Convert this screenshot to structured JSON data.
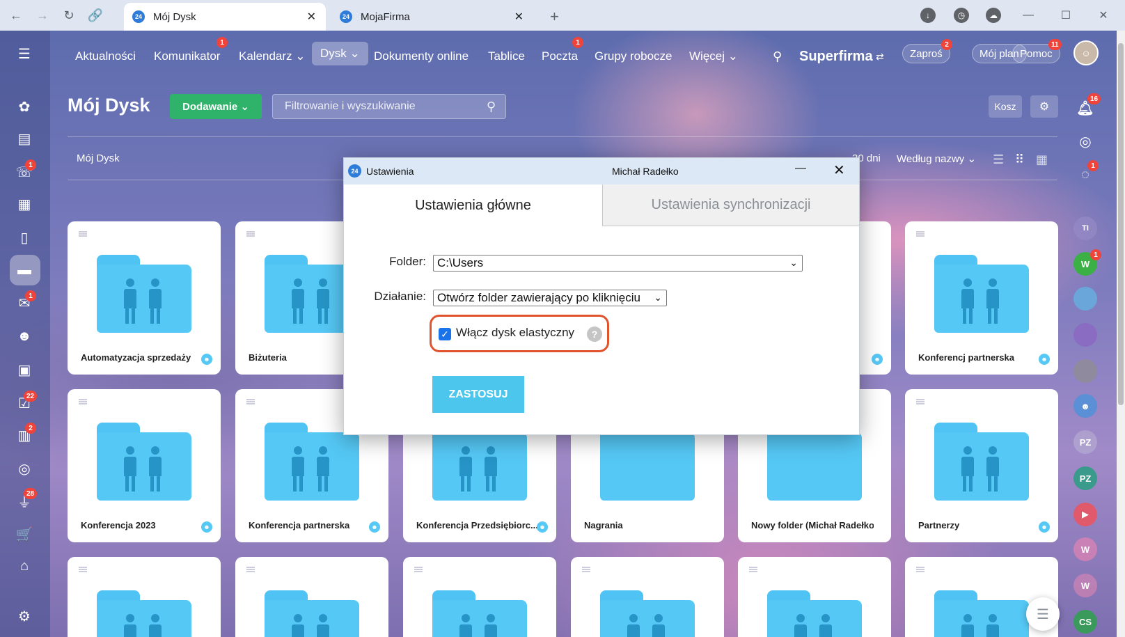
{
  "browser": {
    "tabs": [
      {
        "title": "Mój Dysk",
        "favicon": "24",
        "active": true
      },
      {
        "title": "MojaFirma",
        "favicon": "24",
        "active": false
      }
    ]
  },
  "topnav": {
    "items": [
      {
        "label": "Aktualności"
      },
      {
        "label": "Komunikator",
        "badge": "1"
      },
      {
        "label": "Kalendarz ⌄"
      },
      {
        "label": "Dysk ⌄"
      },
      {
        "label": "Dokumenty online"
      },
      {
        "label": "Tablice"
      },
      {
        "label": "Poczta",
        "badge": "1"
      },
      {
        "label": "Grupy robocze"
      },
      {
        "label": "Więcej ⌄"
      }
    ],
    "company": "Superfirma",
    "invite": "Zaproś",
    "invite_badge": "2",
    "my_plan": "Mój plan",
    "help": "Pomoc",
    "help_badge": "11"
  },
  "left_rail_badges": [
    "1",
    "1",
    "22",
    "2",
    "28"
  ],
  "right_rail": {
    "notify_badge": "16",
    "chat_badge": "1",
    "w_badge": "1",
    "avatars": [
      "TI",
      "W",
      "PZ",
      "PZ",
      "W",
      "W",
      "CS"
    ]
  },
  "page": {
    "title": "Mój Dysk",
    "add_button": "Dodawanie",
    "search_placeholder": "Filtrowanie i wyszukiwanie",
    "trash": "Kosz",
    "breadcrumb": "Mój Dysk",
    "days_text": "30 dni",
    "sort_label": "Według nazwy"
  },
  "folders": [
    {
      "name": "Automatyzacja sprzedaży",
      "shared": true
    },
    {
      "name": "Biżuteria",
      "shared": false
    },
    {
      "name": "Konferencj partnerska",
      "shared": true
    },
    {
      "name": "Konferencja 2023",
      "shared": true
    },
    {
      "name": "Konferencja partnerska",
      "shared": true
    },
    {
      "name": "Konferencja Przedsiębiorc...",
      "shared": true
    },
    {
      "name": "Nagrania",
      "shared": false
    },
    {
      "name": "Nowy folder (Michał Radełko)",
      "shared": false
    },
    {
      "name": "Partnerzy",
      "shared": true
    }
  ],
  "dialog": {
    "title": "Ustawienia",
    "user": "Michał Radełko",
    "tab_main": "Ustawienia główne",
    "tab_sync": "Ustawienia synchronizacji",
    "folder_label": "Folder:",
    "folder_value": "C:\\Users",
    "action_label": "Działanie:",
    "action_value": "Otwórz folder zawierający po kliknięciu",
    "checkbox_label": "Włącz dysk elastyczny",
    "checkbox_checked": true,
    "apply": "ZASTOSUJ"
  },
  "colors": {
    "accent_green": "#2fb36a",
    "folder_blue": "#55c8f5",
    "apply_blue": "#4cc6ec",
    "highlight_red": "#e0532d",
    "badge_red": "#f0433a"
  }
}
